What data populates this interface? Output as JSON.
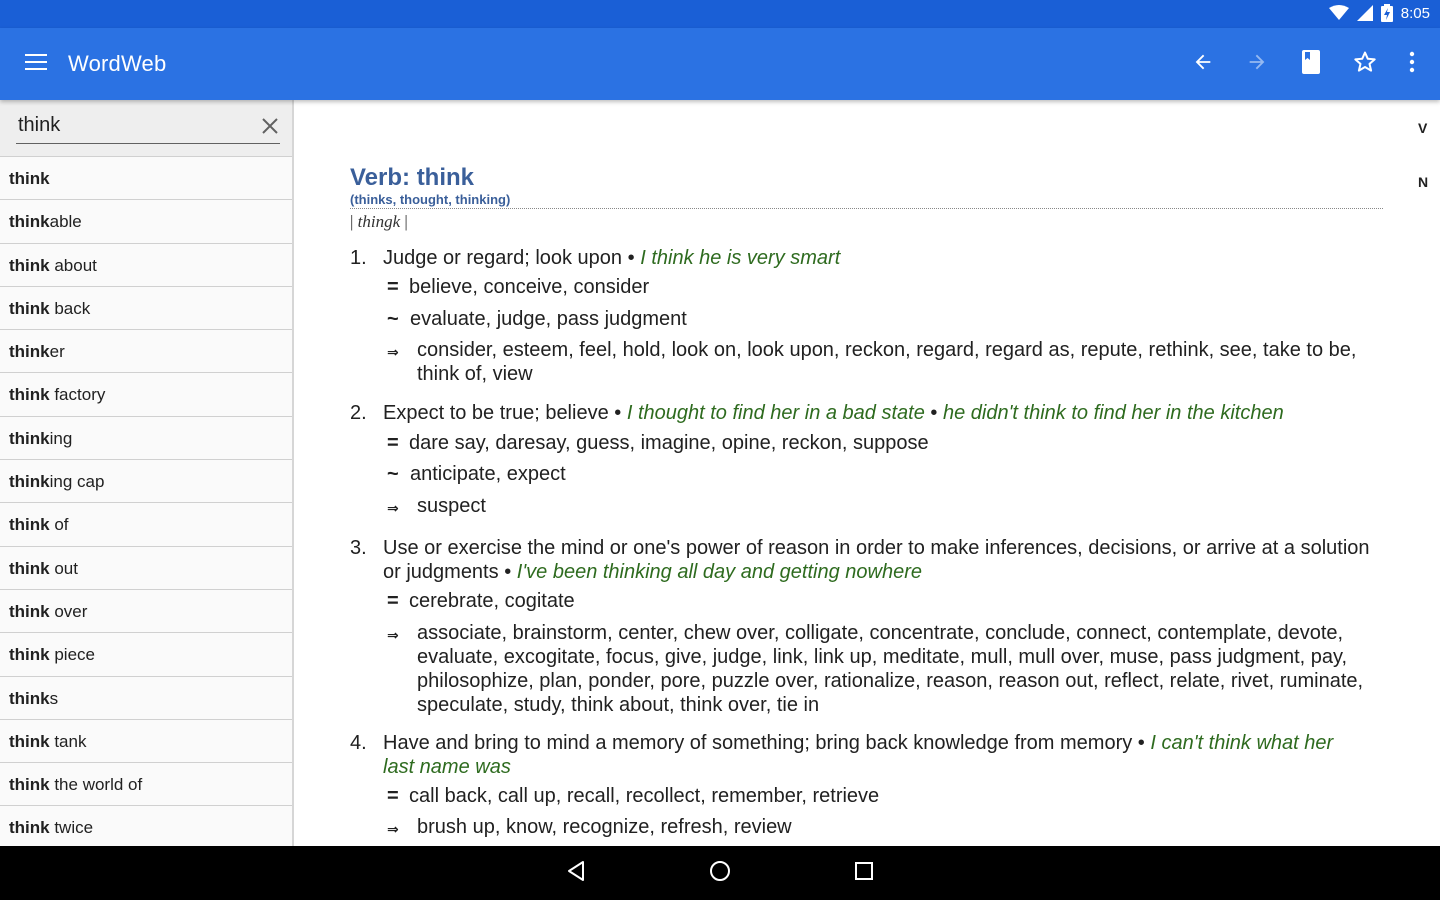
{
  "status_bar": {
    "time": "8:05"
  },
  "app_bar": {
    "title": "WordWeb",
    "icons": [
      "menu-icon",
      "back-arrow-icon",
      "forward-arrow-icon",
      "book-icon",
      "star-icon",
      "more-vert-icon"
    ]
  },
  "search": {
    "value": "think"
  },
  "word_list": [
    {
      "bold": "think",
      "rest": ""
    },
    {
      "bold": "think",
      "rest": "able"
    },
    {
      "bold": "think",
      "rest": " about"
    },
    {
      "bold": "think",
      "rest": " back"
    },
    {
      "bold": "think",
      "rest": "er"
    },
    {
      "bold": "think",
      "rest": " factory"
    },
    {
      "bold": "think",
      "rest": "ing"
    },
    {
      "bold": "think",
      "rest": "ing cap"
    },
    {
      "bold": "think",
      "rest": " of"
    },
    {
      "bold": "think",
      "rest": " out"
    },
    {
      "bold": "think",
      "rest": " over"
    },
    {
      "bold": "think",
      "rest": " piece"
    },
    {
      "bold": "think",
      "rest": "s"
    },
    {
      "bold": "think",
      "rest": " tank"
    },
    {
      "bold": "think",
      "rest": " the world of"
    },
    {
      "bold": "think",
      "rest": " twice"
    }
  ],
  "side_index": [
    "V",
    "N"
  ],
  "entry": {
    "pos_title": "Verb: think",
    "inflections": "(thinks, thought, thinking)",
    "pron_open": "| ",
    "pron": "thingk",
    "pron_close": " |",
    "bullet": "•",
    "senses": [
      {
        "num": "1.",
        "def": "Judge or regard; look upon",
        "examples": [
          "I think he is very smart"
        ],
        "synonyms": "believe, conceive, consider",
        "broader": "evaluate, judge, pass judgment",
        "narrower": "consider, esteem, feel, hold, look on, look upon, reckon, regard, regard as, repute, rethink, see, take to be, think of, view"
      },
      {
        "num": "2.",
        "def": "Expect to be true; believe",
        "examples": [
          "I thought to find her in a bad state",
          "he didn't think to find her in the kitchen"
        ],
        "synonyms": "dare say, daresay, guess, imagine, opine, reckon, suppose",
        "broader": "anticipate, expect",
        "narrower": "suspect"
      },
      {
        "num": "3.",
        "def": "Use or exercise the mind or one's power of reason in order to make inferences, decisions, or arrive at a solution or judgments",
        "examples": [
          "I've been thinking all day and getting nowhere"
        ],
        "synonyms": "cerebrate, cogitate",
        "narrower": "associate, brainstorm, center, chew over, colligate, concentrate, conclude, connect, contemplate, devote, evaluate, excogitate, focus, give, judge, link, link up, meditate, mull, mull over, muse, pass judgment, pay, philosophize, plan, ponder, pore, puzzle over, rationalize, reason, reason out, reflect, relate, rivet, ruminate, speculate, study, think about, think over, tie in"
      },
      {
        "num": "4.",
        "def": "Have and bring to mind a memory of something; bring back knowledge from memory",
        "examples": [
          "I can't think what her last name was"
        ],
        "synonyms": "call back, call up, recall, recollect, remember, retrieve",
        "narrower": "brush up, know, recognize, refresh, review"
      }
    ],
    "symbols": {
      "synonym": "=",
      "broader": "~",
      "narrower": "⇒"
    }
  },
  "nav_bar": {
    "icons": [
      "back-triangle-icon",
      "home-circle-icon",
      "recents-square-icon"
    ]
  }
}
